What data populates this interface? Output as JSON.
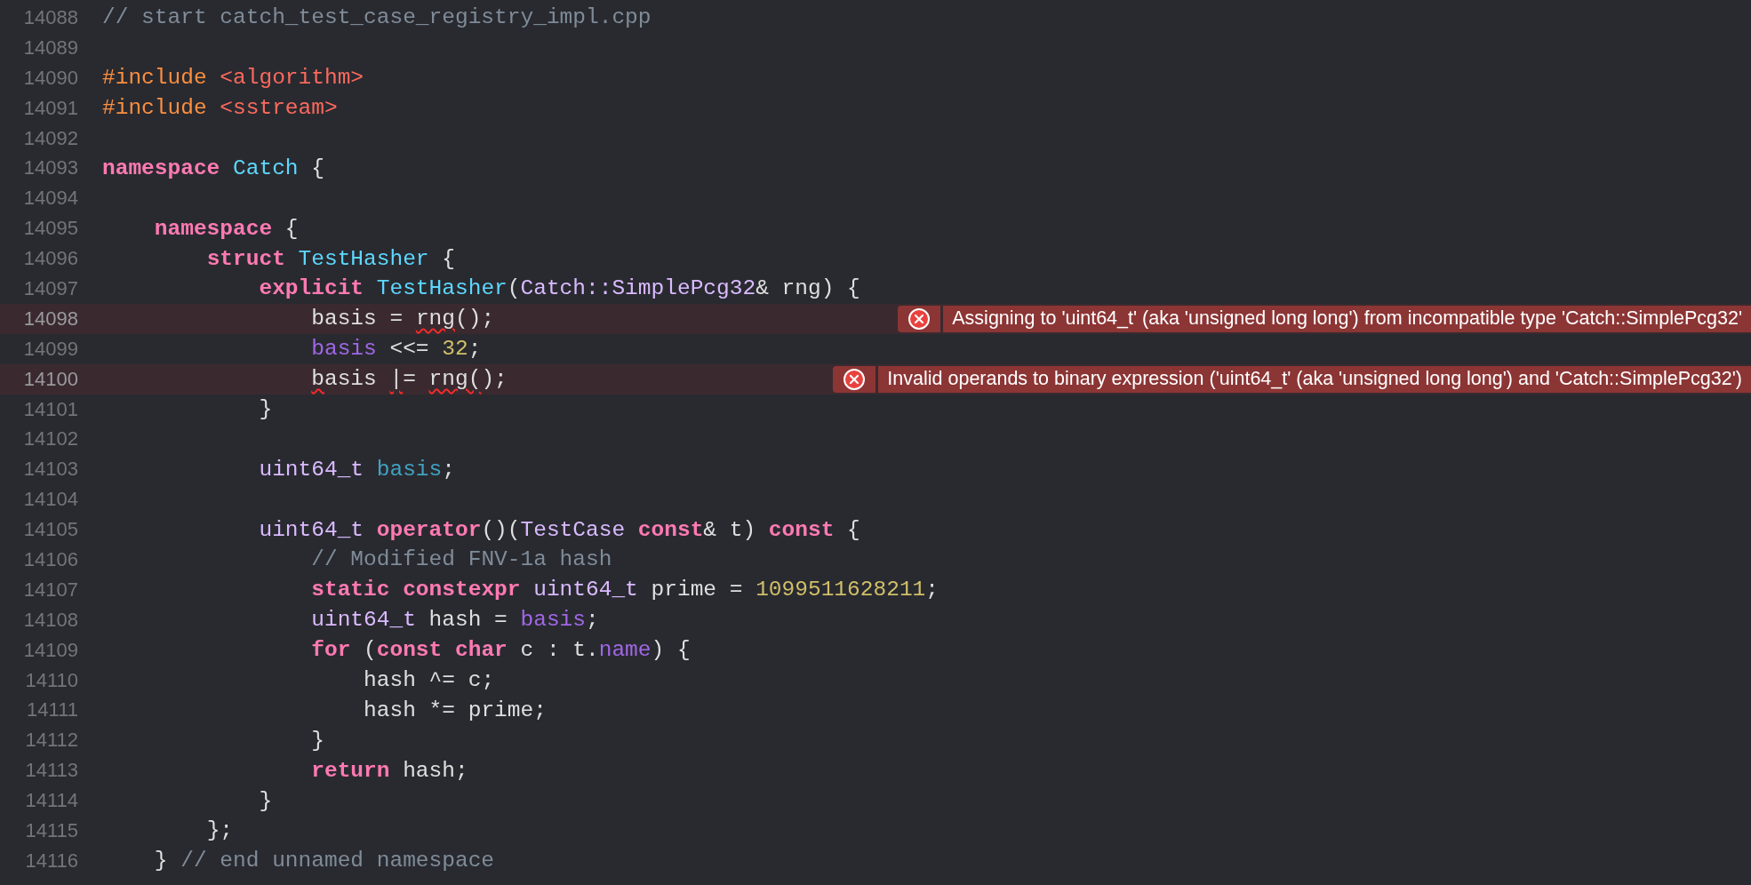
{
  "editor": {
    "lines": [
      {
        "number": "14088",
        "tokens": [
          {
            "text": "// start catch_test_case_registry_impl.cpp",
            "kind": "comment"
          }
        ]
      },
      {
        "number": "14089"
      },
      {
        "number": "14090",
        "tokens": [
          {
            "text": "#include ",
            "kind": "preproc"
          },
          {
            "text": "<algorithm>",
            "kind": "string"
          }
        ]
      },
      {
        "number": "14091",
        "tokens": [
          {
            "text": "#include ",
            "kind": "preproc"
          },
          {
            "text": "<sstream>",
            "kind": "string"
          }
        ]
      },
      {
        "number": "14092"
      },
      {
        "number": "14093",
        "tokens": [
          {
            "text": "namespace ",
            "kind": "keyword"
          },
          {
            "text": "Catch",
            "kind": "decl"
          },
          {
            "text": " {",
            "kind": "plain"
          }
        ]
      },
      {
        "number": "14094"
      },
      {
        "number": "14095",
        "tokens": [
          {
            "text": "    namespace",
            "kind": "keyword"
          },
          {
            "text": " {",
            "kind": "plain"
          }
        ]
      },
      {
        "number": "14096",
        "tokens": [
          {
            "text": "        struct ",
            "kind": "keyword"
          },
          {
            "text": "TestHasher",
            "kind": "decl"
          },
          {
            "text": " {",
            "kind": "plain"
          }
        ]
      },
      {
        "number": "14097",
        "tokens": [
          {
            "text": "            explicit ",
            "kind": "keyword"
          },
          {
            "text": "TestHasher",
            "kind": "decl"
          },
          {
            "text": "(",
            "kind": "plain"
          },
          {
            "text": "Catch::SimplePcg32",
            "kind": "type"
          },
          {
            "text": "& rng) {",
            "kind": "plain"
          }
        ]
      },
      {
        "number": "14098",
        "tokens": [
          {
            "text": "                basis = ",
            "kind": "plain",
            "squiggle": false
          },
          {
            "text": "rng",
            "kind": "plain",
            "squiggle": true
          },
          {
            "text": "();",
            "kind": "plain",
            "squiggle": false
          }
        ],
        "error": "Assigning to 'uint64_t' (aka 'unsigned long long') from incompatible type 'Catch::SimplePcg32'"
      },
      {
        "number": "14099",
        "tokens": [
          {
            "text": "                basis",
            "kind": "member"
          },
          {
            "text": " <<= ",
            "kind": "plain"
          },
          {
            "text": "32",
            "kind": "number"
          },
          {
            "text": ";",
            "kind": "plain"
          }
        ]
      },
      {
        "number": "14100",
        "tokens": [
          {
            "text": "                b",
            "kind": "plain",
            "squiggle": true
          },
          {
            "text": "asis ",
            "kind": "plain",
            "squiggle": false
          },
          {
            "text": "|",
            "kind": "plain",
            "squiggle": true
          },
          {
            "text": "= ",
            "kind": "plain",
            "squiggle": false
          },
          {
            "text": "rng(",
            "kind": "plain",
            "squiggle": true
          },
          {
            "text": ");",
            "kind": "plain",
            "squiggle": false
          }
        ],
        "error": "Invalid operands to binary expression ('uint64_t' (aka 'unsigned long long') and 'Catch::SimplePcg32')"
      },
      {
        "number": "14101",
        "tokens": [
          {
            "text": "            }",
            "kind": "plain"
          }
        ]
      },
      {
        "number": "14102"
      },
      {
        "number": "14103",
        "tokens": [
          {
            "text": "            uint64_t ",
            "kind": "type"
          },
          {
            "text": "basis",
            "kind": "ivar"
          },
          {
            "text": ";",
            "kind": "plain"
          }
        ]
      },
      {
        "number": "14104"
      },
      {
        "number": "14105",
        "tokens": [
          {
            "text": "            uint64_t ",
            "kind": "type"
          },
          {
            "text": "operator",
            "kind": "keyword"
          },
          {
            "text": "()(",
            "kind": "plain"
          },
          {
            "text": "TestCase ",
            "kind": "type"
          },
          {
            "text": "const",
            "kind": "keyword"
          },
          {
            "text": "& t) ",
            "kind": "plain"
          },
          {
            "text": "const",
            "kind": "keyword"
          },
          {
            "text": " {",
            "kind": "plain"
          }
        ]
      },
      {
        "number": "14106",
        "tokens": [
          {
            "text": "                // Modified FNV-1a hash",
            "kind": "comment"
          }
        ]
      },
      {
        "number": "14107",
        "tokens": [
          {
            "text": "                static constexpr ",
            "kind": "keyword"
          },
          {
            "text": "uint64_t",
            "kind": "type"
          },
          {
            "text": " prime = ",
            "kind": "plain"
          },
          {
            "text": "1099511628211",
            "kind": "number"
          },
          {
            "text": ";",
            "kind": "plain"
          }
        ]
      },
      {
        "number": "14108",
        "tokens": [
          {
            "text": "                uint64_t",
            "kind": "type"
          },
          {
            "text": " hash = ",
            "kind": "plain"
          },
          {
            "text": "basis",
            "kind": "member"
          },
          {
            "text": ";",
            "kind": "plain"
          }
        ]
      },
      {
        "number": "14109",
        "tokens": [
          {
            "text": "                for",
            "kind": "keyword"
          },
          {
            "text": " (",
            "kind": "plain"
          },
          {
            "text": "const char",
            "kind": "keyword"
          },
          {
            "text": " c : t.",
            "kind": "plain"
          },
          {
            "text": "name",
            "kind": "member"
          },
          {
            "text": ") {",
            "kind": "plain"
          }
        ]
      },
      {
        "number": "14110",
        "tokens": [
          {
            "text": "                    hash ^= c;",
            "kind": "plain"
          }
        ]
      },
      {
        "number": "14111",
        "tokens": [
          {
            "text": "                    hash *= prime;",
            "kind": "plain"
          }
        ]
      },
      {
        "number": "14112",
        "tokens": [
          {
            "text": "                }",
            "kind": "plain"
          }
        ]
      },
      {
        "number": "14113",
        "tokens": [
          {
            "text": "                return",
            "kind": "keyword"
          },
          {
            "text": " hash;",
            "kind": "plain"
          }
        ]
      },
      {
        "number": "14114",
        "tokens": [
          {
            "text": "            }",
            "kind": "plain"
          }
        ]
      },
      {
        "number": "14115",
        "tokens": [
          {
            "text": "        };",
            "kind": "plain"
          }
        ]
      },
      {
        "number": "14116",
        "tokens": [
          {
            "text": "    } ",
            "kind": "plain"
          },
          {
            "text": "// end unnamed namespace",
            "kind": "comment"
          }
        ]
      }
    ]
  }
}
